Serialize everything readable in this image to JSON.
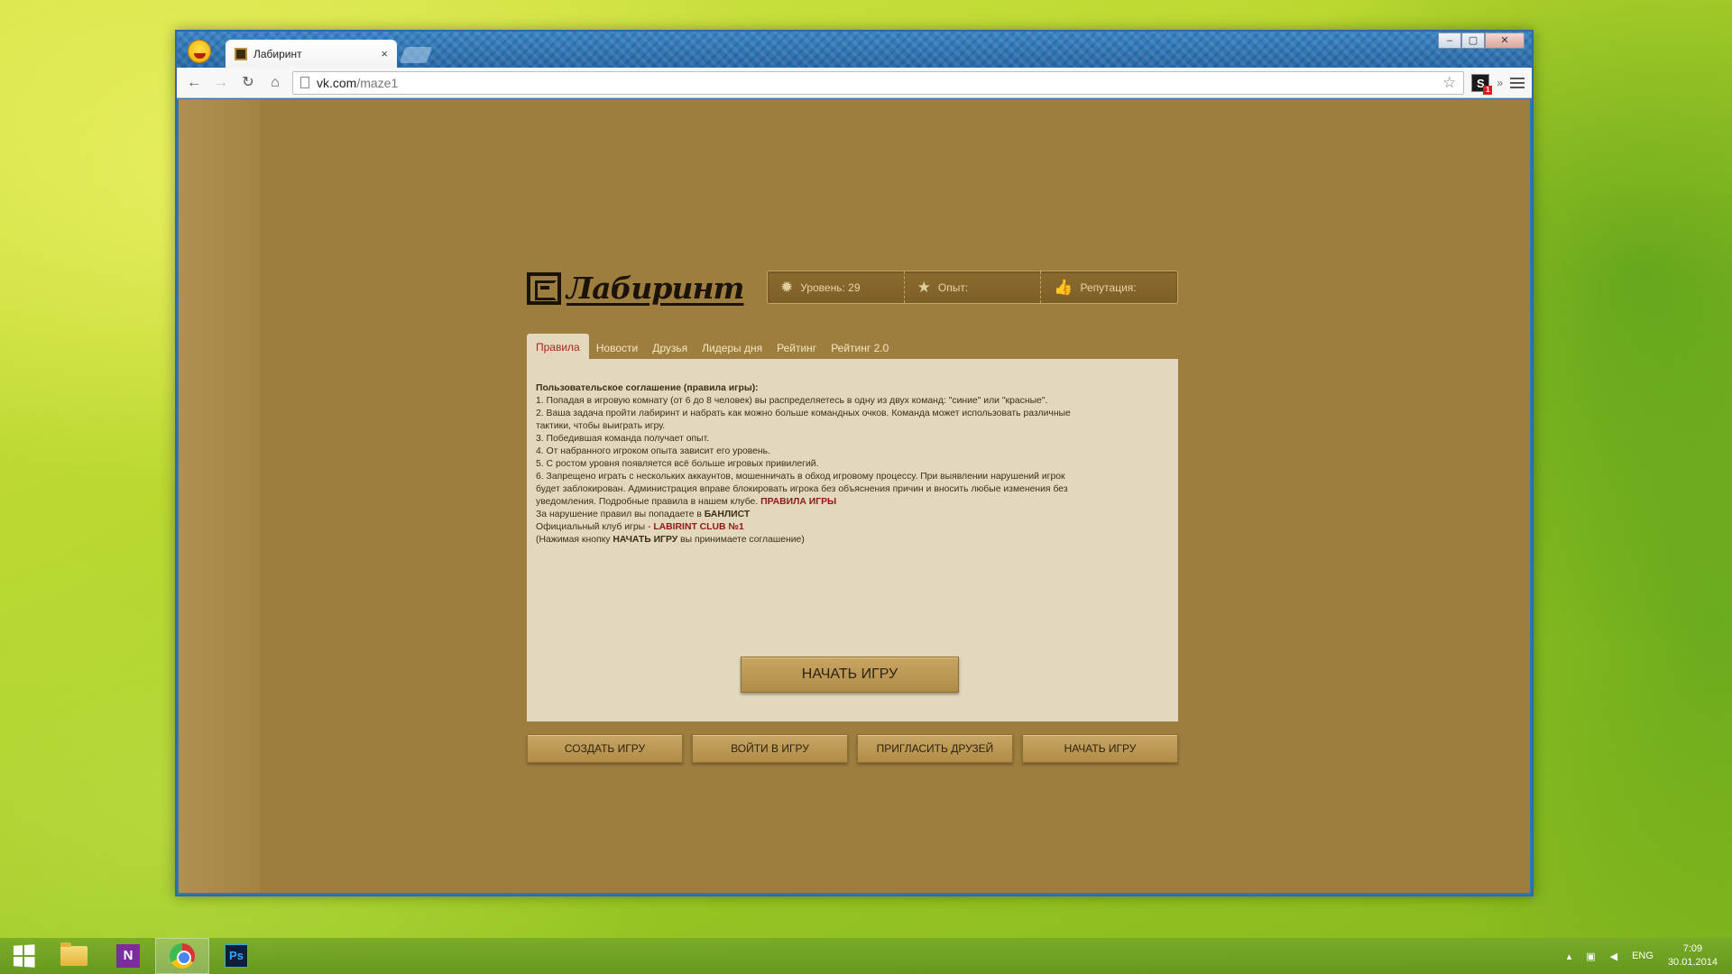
{
  "browser": {
    "tab_title": "Лабиринт",
    "tab_close": "×",
    "url_host": "vk.com",
    "url_path": "/maze1",
    "window_controls": [
      "–",
      "▢",
      "✕"
    ],
    "extension_badge": "S"
  },
  "app": {
    "logo_text": "Лабиринт",
    "stats": {
      "level": "Уровень: 29",
      "experience": "Опыт:",
      "reputation": "Репутация:"
    },
    "tabs": [
      "Правила",
      "Новости",
      "Друзья",
      "Лидеры дня",
      "Рейтинг",
      "Рейтинг 2.0"
    ],
    "active_tab": "Правила",
    "rules": {
      "title": "Пользовательское соглашение (правила игры):",
      "item1": "1. Попадая в игровую комнату (от 6 до 8 человек) вы распределяетесь в одну из двух команд: \"синие\" или \"красные\".",
      "item2": "2. Ваша задача пройти лабиринт и набрать как можно больше командных очков. Команда может использовать различные тактики, чтобы выиграть игру.",
      "item3": "3. Победившая команда получает опыт.",
      "item4": "4. От набранного игроком опыта зависит его уровень.",
      "item5": "5. С ростом уровня появляется всё больше игровых привилегий.",
      "item6": "6. Запрещено играть с нескольких аккаунтов, мошенничать в обход игровому процессу. При выявлении нарушений игрок будет заблокирован. Администрация вправе блокировать игрока без объяснения причин и вносить любые изменения без уведомления. Подробные правила  в нашем клубе.",
      "rules_link": "ПРАВИЛА ИГРЫ",
      "ban_text": "За нарушение правил вы попадаете в",
      "ban_link": "БАНЛИСТ",
      "club_text": "Официальный клуб игры -",
      "club_link": "LABIRINT CLUB №1",
      "agree_prefix": "(Нажимая кнопку",
      "agree_bold": "НАЧАТЬ ИГРУ",
      "agree_suffix": "вы принимаете соглашение)"
    },
    "start_button": "НАЧАТЬ ИГРУ",
    "actions": [
      "СОЗДАТЬ ИГРУ",
      "ВОЙТИ В ИГРУ",
      "ПРИГЛАСИТЬ ДРУЗЕЙ",
      "НАЧАТЬ ИГРУ"
    ]
  },
  "taskbar": {
    "onenote_label": "N",
    "photoshop_label": "Ps",
    "language": "ENG",
    "time": "7:09",
    "date": "30.01.2014"
  },
  "colors": {
    "page_bg": "#9e7e3f",
    "panel_bg": "#e3d8bd",
    "active_tab_text": "#b0221c",
    "link_red": "#8d1a14"
  }
}
